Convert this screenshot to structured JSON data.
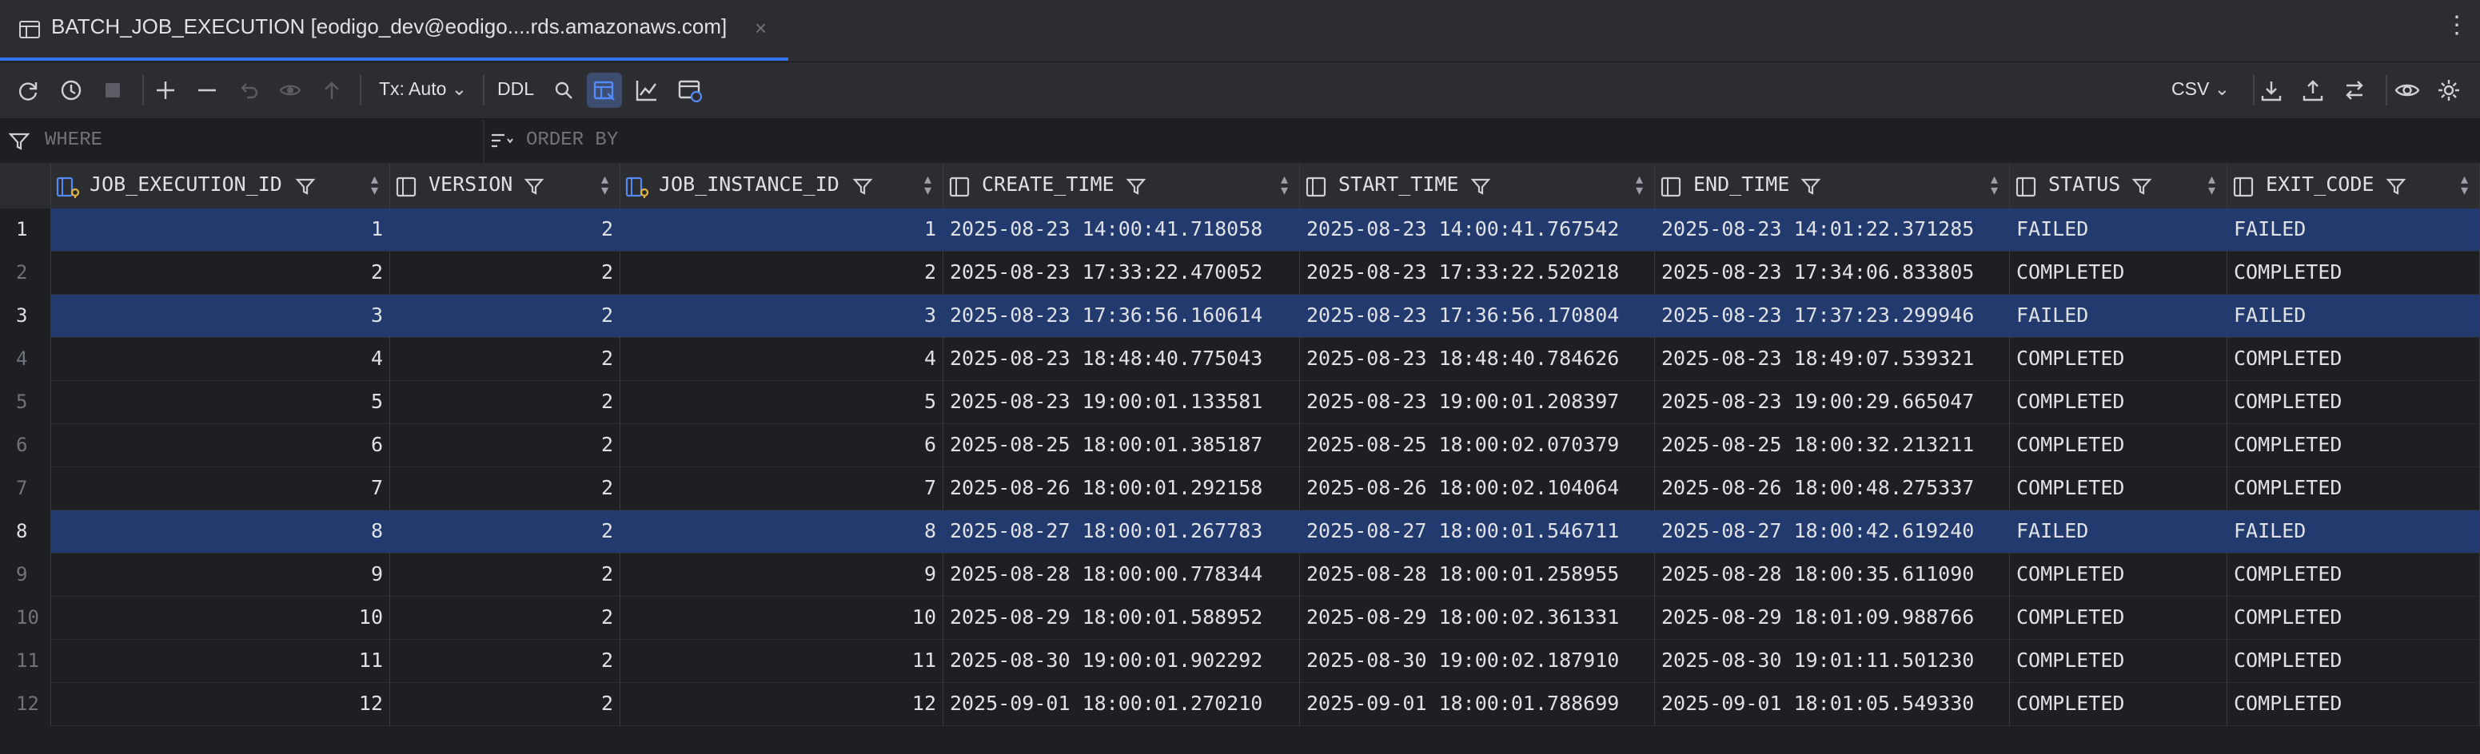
{
  "tab": {
    "title": "BATCH_JOB_EXECUTION [eodigo_dev@eodigo....rds.amazonaws.com]",
    "close": "×"
  },
  "window": {
    "more": "⋮"
  },
  "toolbar": {
    "tx_mode": "Tx: Auto",
    "ddl": "DDL",
    "export_format": "CSV"
  },
  "filters": {
    "where": "WHERE",
    "order_by": "ORDER BY"
  },
  "columns": [
    {
      "name": "JOB_EXECUTION_ID",
      "icon": "key-column-icon"
    },
    {
      "name": "VERSION",
      "icon": "column-icon"
    },
    {
      "name": "JOB_INSTANCE_ID",
      "icon": "key-column-icon"
    },
    {
      "name": "CREATE_TIME",
      "icon": "column-icon"
    },
    {
      "name": "START_TIME",
      "icon": "column-icon"
    },
    {
      "name": "END_TIME",
      "icon": "column-icon"
    },
    {
      "name": "STATUS",
      "icon": "column-icon"
    },
    {
      "name": "EXIT_CODE",
      "icon": "column-icon"
    }
  ],
  "selection_color": "#233a6e",
  "rows": [
    {
      "n": "1",
      "selected": true,
      "c": [
        "1",
        "2",
        "1",
        "2025-08-23 14:00:41.718058",
        "2025-08-23 14:00:41.767542",
        "2025-08-23 14:01:22.371285",
        "FAILED",
        "FAILED"
      ]
    },
    {
      "n": "2",
      "selected": false,
      "c": [
        "2",
        "2",
        "2",
        "2025-08-23 17:33:22.470052",
        "2025-08-23 17:33:22.520218",
        "2025-08-23 17:34:06.833805",
        "COMPLETED",
        "COMPLETED"
      ]
    },
    {
      "n": "3",
      "selected": true,
      "c": [
        "3",
        "2",
        "3",
        "2025-08-23 17:36:56.160614",
        "2025-08-23 17:36:56.170804",
        "2025-08-23 17:37:23.299946",
        "FAILED",
        "FAILED"
      ]
    },
    {
      "n": "4",
      "selected": false,
      "c": [
        "4",
        "2",
        "4",
        "2025-08-23 18:48:40.775043",
        "2025-08-23 18:48:40.784626",
        "2025-08-23 18:49:07.539321",
        "COMPLETED",
        "COMPLETED"
      ]
    },
    {
      "n": "5",
      "selected": false,
      "c": [
        "5",
        "2",
        "5",
        "2025-08-23 19:00:01.133581",
        "2025-08-23 19:00:01.208397",
        "2025-08-23 19:00:29.665047",
        "COMPLETED",
        "COMPLETED"
      ]
    },
    {
      "n": "6",
      "selected": false,
      "c": [
        "6",
        "2",
        "6",
        "2025-08-25 18:00:01.385187",
        "2025-08-25 18:00:02.070379",
        "2025-08-25 18:00:32.213211",
        "COMPLETED",
        "COMPLETED"
      ]
    },
    {
      "n": "7",
      "selected": false,
      "c": [
        "7",
        "2",
        "7",
        "2025-08-26 18:00:01.292158",
        "2025-08-26 18:00:02.104064",
        "2025-08-26 18:00:48.275337",
        "COMPLETED",
        "COMPLETED"
      ]
    },
    {
      "n": "8",
      "selected": true,
      "c": [
        "8",
        "2",
        "8",
        "2025-08-27 18:00:01.267783",
        "2025-08-27 18:00:01.546711",
        "2025-08-27 18:00:42.619240",
        "FAILED",
        "FAILED"
      ]
    },
    {
      "n": "9",
      "selected": false,
      "c": [
        "9",
        "2",
        "9",
        "2025-08-28 18:00:00.778344",
        "2025-08-28 18:00:01.258955",
        "2025-08-28 18:00:35.611090",
        "COMPLETED",
        "COMPLETED"
      ]
    },
    {
      "n": "10",
      "selected": false,
      "c": [
        "10",
        "2",
        "10",
        "2025-08-29 18:00:01.588952",
        "2025-08-29 18:00:02.361331",
        "2025-08-29 18:01:09.988766",
        "COMPLETED",
        "COMPLETED"
      ]
    },
    {
      "n": "11",
      "selected": false,
      "c": [
        "11",
        "2",
        "11",
        "2025-08-30 19:00:01.902292",
        "2025-08-30 19:00:02.187910",
        "2025-08-30 19:01:11.501230",
        "COMPLETED",
        "COMPLETED"
      ]
    },
    {
      "n": "12",
      "selected": false,
      "c": [
        "12",
        "2",
        "12",
        "2025-09-01 18:00:01.270210",
        "2025-09-01 18:00:01.788699",
        "2025-09-01 18:01:05.549330",
        "COMPLETED",
        "COMPLETED"
      ]
    }
  ]
}
